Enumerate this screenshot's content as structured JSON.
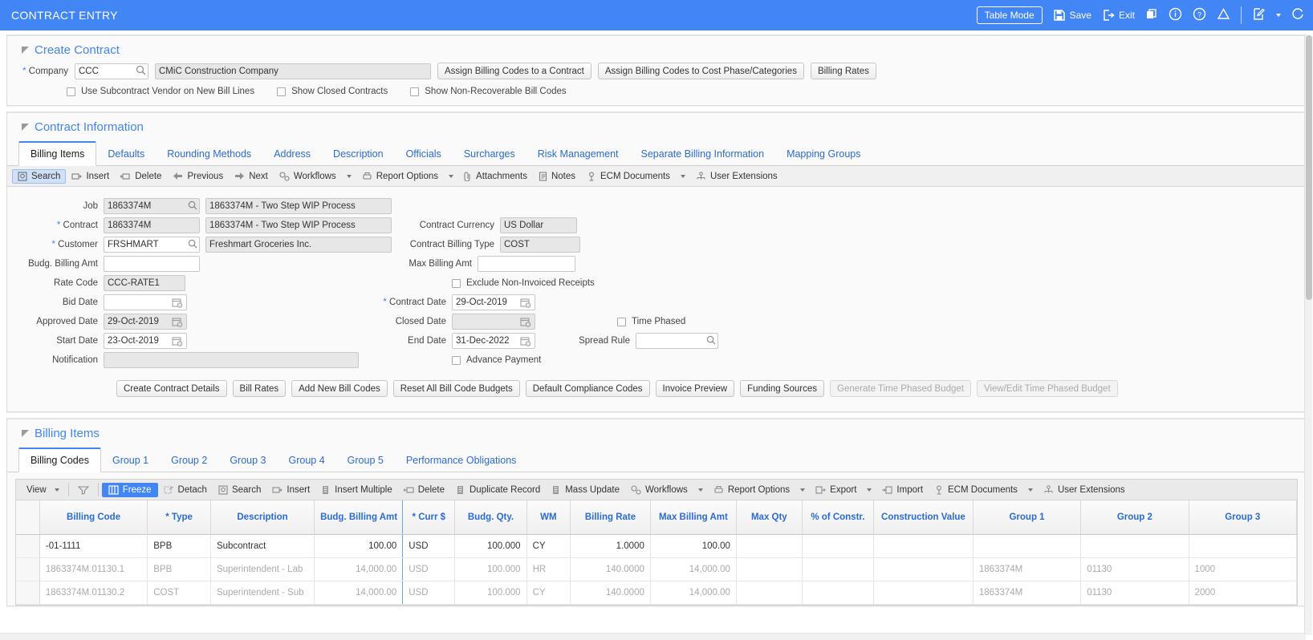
{
  "titlebar": {
    "app_title": "CONTRACT ENTRY",
    "table_mode": "Table Mode",
    "save": "Save",
    "exit": "Exit",
    "accent": "#4285f4",
    "icons": [
      "copy-icon",
      "info-icon",
      "help-icon",
      "warning-icon",
      "edit-icon",
      "chevron-down-icon",
      "refresh-icon"
    ]
  },
  "create_contract": {
    "title": "Create Contract",
    "company_label": "Company",
    "company_required": "*",
    "company_code": "CCC",
    "company_name": "CMiC Construction Company",
    "buttons": [
      "Assign Billing Codes to a Contract",
      "Assign Billing Codes to Cost Phase/Categories",
      "Billing Rates"
    ],
    "checkboxes": [
      "Use Subcontract Vendor on New Bill Lines",
      "Show Closed Contracts",
      "Show Non-Recoverable Bill Codes"
    ]
  },
  "contract_information": {
    "title": "Contract Information",
    "tabs": [
      "Billing Items",
      "Defaults",
      "Rounding Methods",
      "Address",
      "Description",
      "Officials",
      "Surcharges",
      "Risk Management",
      "Separate Billing Information",
      "Mapping Groups"
    ],
    "active_tab": "Billing Items",
    "actions": [
      {
        "label": "Search",
        "icon": "search-icon",
        "selected": true
      },
      {
        "label": "Insert",
        "icon": "insert-icon",
        "selected": false
      },
      {
        "label": "Delete",
        "icon": "delete-icon",
        "selected": false
      },
      {
        "label": "Previous",
        "icon": "arrow-left-icon",
        "selected": false
      },
      {
        "label": "Next",
        "icon": "arrow-right-icon",
        "selected": false
      },
      {
        "label": "Workflows",
        "icon": "workflow-icon",
        "selected": false,
        "caret": true
      },
      {
        "label": "Report Options",
        "icon": "printer-icon",
        "selected": false,
        "caret": true
      },
      {
        "label": "Attachments",
        "icon": "paperclip-icon",
        "selected": false
      },
      {
        "label": "Notes",
        "icon": "notes-icon",
        "selected": false
      },
      {
        "label": "ECM Documents",
        "icon": "ecm-icon",
        "selected": false,
        "caret": true
      },
      {
        "label": "User Extensions",
        "icon": "user-extensions-icon",
        "selected": false
      }
    ],
    "fields": {
      "job_label": "Job",
      "job_code": "1863374M",
      "job_desc": "1863374M - Two Step WIP Process",
      "contract_label": "Contract",
      "contract_required": "*",
      "contract_code": "1863374M",
      "contract_desc": "1863374M - Two Step WIP Process",
      "customer_label": "Customer",
      "customer_required": "*",
      "customer_code": "FRSHMART",
      "customer_desc": "Freshmart Groceries Inc.",
      "budg_billing_amt_label": "Budg. Billing Amt",
      "budg_billing_amt": "",
      "rate_code_label": "Rate Code",
      "rate_code": "CCC-RATE1",
      "bid_date_label": "Bid Date",
      "bid_date": "",
      "approved_date_label": "Approved Date",
      "approved_date": "29-Oct-2019",
      "start_date_label": "Start Date",
      "start_date": "23-Oct-2019",
      "notification_label": "Notification",
      "notification": "",
      "contract_currency_label": "Contract Currency",
      "contract_currency": "US Dollar",
      "contract_billing_type_label": "Contract Billing Type",
      "contract_billing_type": "COST",
      "max_billing_amt_label": "Max Billing Amt",
      "max_billing_amt": "",
      "exclude_receipts_label": "Exclude Non-Invoiced Receipts",
      "contract_date_label": "Contract Date",
      "contract_date_required": "*",
      "contract_date": "29-Oct-2019",
      "closed_date_label": "Closed Date",
      "closed_date": "",
      "end_date_label": "End Date",
      "end_date": "31-Dec-2022",
      "advance_payment_label": "Advance Payment",
      "time_phased_label": "Time Phased",
      "spread_rule_label": "Spread Rule",
      "spread_rule": ""
    },
    "buttons": [
      {
        "label": "Create Contract Details",
        "disabled": false
      },
      {
        "label": "Bill Rates",
        "disabled": false
      },
      {
        "label": "Add New Bill Codes",
        "disabled": false
      },
      {
        "label": "Reset All Bill Code Budgets",
        "disabled": false
      },
      {
        "label": "Default Compliance Codes",
        "disabled": false
      },
      {
        "label": "Invoice Preview",
        "disabled": false
      },
      {
        "label": "Funding Sources",
        "disabled": false
      },
      {
        "label": "Generate Time Phased Budget",
        "disabled": true
      },
      {
        "label": "View/Edit Time Phased Budget",
        "disabled": true
      }
    ]
  },
  "billing_items": {
    "title": "Billing Items",
    "tabs": [
      "Billing Codes",
      "Group 1",
      "Group 2",
      "Group 3",
      "Group 4",
      "Group 5",
      "Performance Obligations"
    ],
    "active_tab": "Billing Codes",
    "gridbar": [
      {
        "label": "View",
        "icon": "view-icon",
        "caret": true,
        "on": false
      },
      {
        "label": "",
        "icon": "filter-icon",
        "caret": false,
        "on": false
      },
      {
        "label": "Freeze",
        "icon": "freeze-icon",
        "caret": false,
        "on": true
      },
      {
        "label": "Detach",
        "icon": "detach-icon",
        "caret": false,
        "on": false
      },
      {
        "label": "Search",
        "icon": "search-icon",
        "caret": false,
        "on": false
      },
      {
        "label": "Insert",
        "icon": "insert-icon",
        "caret": false,
        "on": false
      },
      {
        "label": "Insert Multiple",
        "icon": "insert-multiple-icon",
        "caret": false,
        "on": false
      },
      {
        "label": "Delete",
        "icon": "delete-icon",
        "caret": false,
        "on": false
      },
      {
        "label": "Duplicate Record",
        "icon": "duplicate-icon",
        "caret": false,
        "on": false
      },
      {
        "label": "Mass Update",
        "icon": "mass-update-icon",
        "caret": false,
        "on": false
      },
      {
        "label": "Workflows",
        "icon": "workflow-icon",
        "caret": true,
        "on": false
      },
      {
        "label": "Report Options",
        "icon": "printer-icon",
        "caret": true,
        "on": false
      },
      {
        "label": "Export",
        "icon": "export-icon",
        "caret": true,
        "on": false
      },
      {
        "label": "Import",
        "icon": "import-icon",
        "caret": false,
        "on": false
      },
      {
        "label": "ECM Documents",
        "icon": "ecm-icon",
        "caret": true,
        "on": false
      },
      {
        "label": "User Extensions",
        "icon": "user-extensions-icon",
        "caret": false,
        "on": false
      }
    ],
    "table": {
      "columns": [
        "Billing Code",
        "* Type",
        "Description",
        "Budg. Billing Amt",
        "* Curr $",
        "Budg. Qty.",
        "WM",
        "Billing Rate",
        "Max Billing Amt",
        "Max Qty",
        "% of Constr.",
        "Construction Value",
        "Group 1",
        "Group 2",
        "Group 3"
      ],
      "rows": [
        {
          "dim": false,
          "cells": [
            "-01-1111",
            "BPB",
            "Subcontract",
            "100.00",
            "USD",
            "100.000",
            "CY",
            "1.0000",
            "100.00",
            "",
            "",
            "",
            "",
            "",
            ""
          ]
        },
        {
          "dim": true,
          "cells": [
            "1863374M.01130.1",
            "BPB",
            "Superintendent - Lab",
            "14,000.00",
            "USD",
            "100.000",
            "HR",
            "140.0000",
            "14,000.00",
            "",
            "",
            "",
            "1863374M",
            "01130",
            "1000"
          ]
        },
        {
          "dim": true,
          "cells": [
            "1863374M.01130.2",
            "COST",
            "Superintendent - Sub",
            "14,000.00",
            "USD",
            "100.000",
            "CY",
            "140.0000",
            "14,000.00",
            "",
            "",
            "",
            "1863374M",
            "01130",
            "2000"
          ]
        }
      ]
    }
  }
}
